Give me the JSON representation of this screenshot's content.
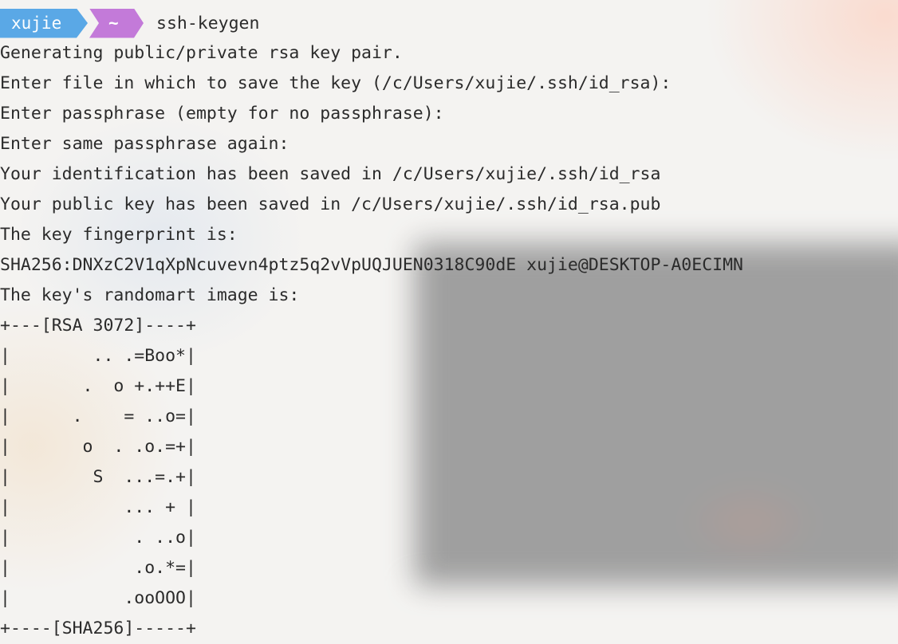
{
  "prompt": {
    "user": "xujie",
    "directory": "~",
    "command": "ssh-keygen"
  },
  "output_lines": [
    "Generating public/private rsa key pair.",
    "Enter file in which to save the key (/c/Users/xujie/.ssh/id_rsa):",
    "Enter passphrase (empty for no passphrase):",
    "Enter same passphrase again:",
    "Your identification has been saved in /c/Users/xujie/.ssh/id_rsa",
    "Your public key has been saved in /c/Users/xujie/.ssh/id_rsa.pub",
    "The key fingerprint is:",
    "SHA256:DNXzC2V1qXpNcuvevn4ptz5q2vVpUQJUEN0318C90dE xujie@DESKTOP-A0ECIMN",
    "The key's randomart image is:"
  ],
  "randomart": [
    "+---[RSA 3072]----+",
    "|        .. .=Boo*|",
    "|       .  o +.++E|",
    "|      .    = ..o=|",
    "|       o  . .o.=+|",
    "|        S  ...=.+|",
    "|           ... + |",
    "|            . ..o|",
    "|            .o.*=|",
    "|           .ooOOO|",
    "+----[SHA256]-----+"
  ],
  "colors": {
    "user_segment": "#5aa8e6",
    "directory_segment": "#c37ad9",
    "text": "#2b2b2b"
  }
}
